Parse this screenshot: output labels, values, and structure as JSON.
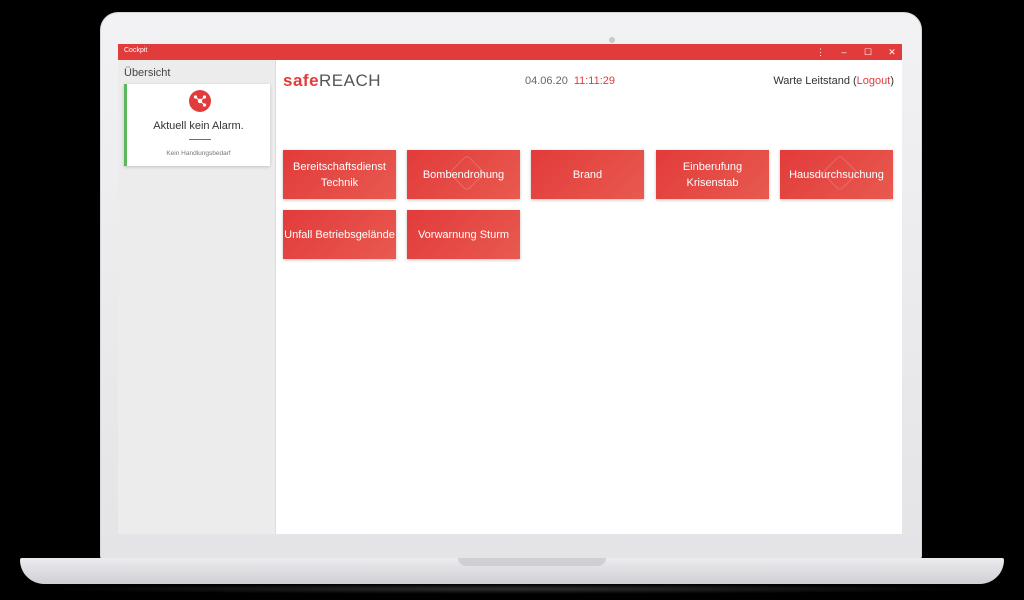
{
  "window": {
    "title": "Cockpit",
    "controls": [
      "⋮",
      "–",
      "☐",
      "✕"
    ]
  },
  "sidebar": {
    "heading": "Übersicht",
    "alarm_card": {
      "title": "Aktuell kein Alarm.",
      "subtitle": "Kein Handlungsbedarf",
      "icon": "alarm-network-icon"
    }
  },
  "header": {
    "logo_safe": "safe",
    "logo_reach": "REACH",
    "date": "04.06.20",
    "time": "11:11:29",
    "user": "Warte Leitstand (",
    "logout": "Logout",
    "user_suffix": ")"
  },
  "tiles": [
    {
      "label": "Bereitschaftsdienst Technik"
    },
    {
      "label": "Bombendrohung"
    },
    {
      "label": "Brand"
    },
    {
      "label": "Einberufung Krisenstab"
    },
    {
      "label": "Hausdurchsuchung"
    },
    {
      "label": "Unfall Betriebsgelände"
    },
    {
      "label": "Vorwarnung Sturm"
    }
  ],
  "colors": {
    "accent": "#e23b3b",
    "ok": "#5cb85c",
    "sidebar_bg": "#ececec"
  }
}
